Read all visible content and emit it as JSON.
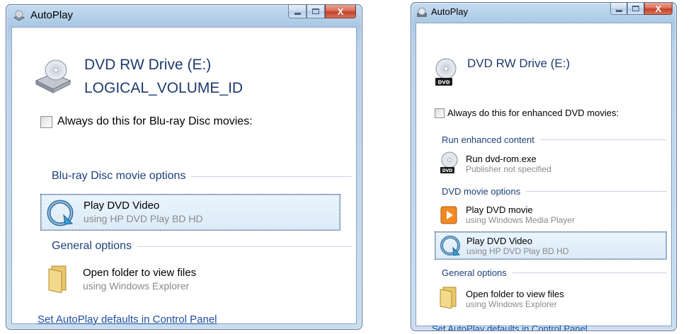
{
  "colors": {
    "frame_blue": "#a9c8e4",
    "section_text": "#1e3f7a",
    "link": "#1b4ea3",
    "subtext": "#8a8a8a",
    "close_red": "#c4402a"
  },
  "window_left": {
    "title": "AutoPlay",
    "title_icon": "autoplay-icon",
    "controls": {
      "minimize": "minimize",
      "maximize": "maximize",
      "close": "X"
    },
    "drive_icon": "dvd-drive-icon",
    "drive_name": "DVD RW Drive (E:)",
    "volume_label": "LOGICAL_VOLUME_ID",
    "checkbox": {
      "label": "Always do this for Blu-ray Disc movies:",
      "checked": false
    },
    "sections": [
      {
        "label": "Blu-ray Disc movie options",
        "options": [
          {
            "title": "Play DVD Video",
            "subtitle": "using HP DVD Play BD HD",
            "icon": "hp-dvd-play-icon",
            "selected": true
          }
        ]
      },
      {
        "label": "General options",
        "options": [
          {
            "title": "Open folder to view files",
            "subtitle": "using Windows Explorer",
            "icon": "folder-icon",
            "selected": false
          }
        ]
      }
    ],
    "footer_link": "Set AutoPlay defaults in Control Panel"
  },
  "window_right": {
    "title": "AutoPlay",
    "title_icon": "autoplay-icon",
    "controls": {
      "minimize": "minimize",
      "maximize": "maximize",
      "close": "X"
    },
    "drive_icon": "dvd-disc-icon",
    "drive_badge": "DVD",
    "drive_name": "DVD RW Drive (E:)",
    "checkbox": {
      "label": "Always do this for enhanced DVD movies:",
      "checked": false
    },
    "sections": [
      {
        "label": "Run enhanced content",
        "options": [
          {
            "title": "Run dvd-rom.exe",
            "subtitle": "Publisher not specified",
            "icon": "dvd-disc-icon",
            "badge": "DVD",
            "selected": false
          }
        ]
      },
      {
        "label": "DVD movie options",
        "options": [
          {
            "title": "Play DVD movie",
            "subtitle": "using Windows Media Player",
            "icon": "media-player-icon",
            "selected": false
          },
          {
            "title": "Play DVD Video",
            "subtitle": "using HP DVD Play BD HD",
            "icon": "hp-dvd-play-icon",
            "selected": true
          }
        ]
      },
      {
        "label": "General options",
        "options": [
          {
            "title": "Open folder to view files",
            "subtitle": "using Windows Explorer",
            "icon": "folder-icon",
            "selected": false
          }
        ]
      }
    ],
    "footer_link": "Set AutoPlay defaults in Control Panel"
  }
}
